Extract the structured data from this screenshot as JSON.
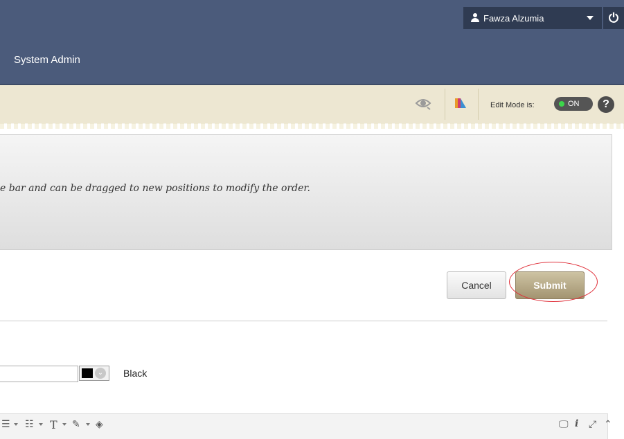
{
  "header": {
    "user_name": "Fawza Alzumia",
    "nav_tab": "System Admin"
  },
  "editbar": {
    "edit_mode_label": "Edit Mode is:",
    "edit_mode_state": "ON",
    "help_label": "?"
  },
  "info": {
    "instructions": "e bar and can be dragged to new positions to modify the order."
  },
  "actions": {
    "cancel_label": "Cancel",
    "submit_label": "Submit"
  },
  "form": {
    "text_value": "",
    "color_name": "Black",
    "color_value": "#000000"
  },
  "colors": {
    "header_bg": "#4b5b7b",
    "editbar_bg": "#ede7d2",
    "submit_bg": "#a39471",
    "highlight": "#e0303a"
  },
  "editor_toolbar": {
    "icons": [
      "align-icon",
      "unordered-list-icon",
      "ordered-list-icon",
      "text-format-icon",
      "highlight-pen-icon",
      "eraser-icon",
      "preview-icon",
      "info-icon",
      "fullscreen-icon",
      "collapse-icon"
    ]
  }
}
